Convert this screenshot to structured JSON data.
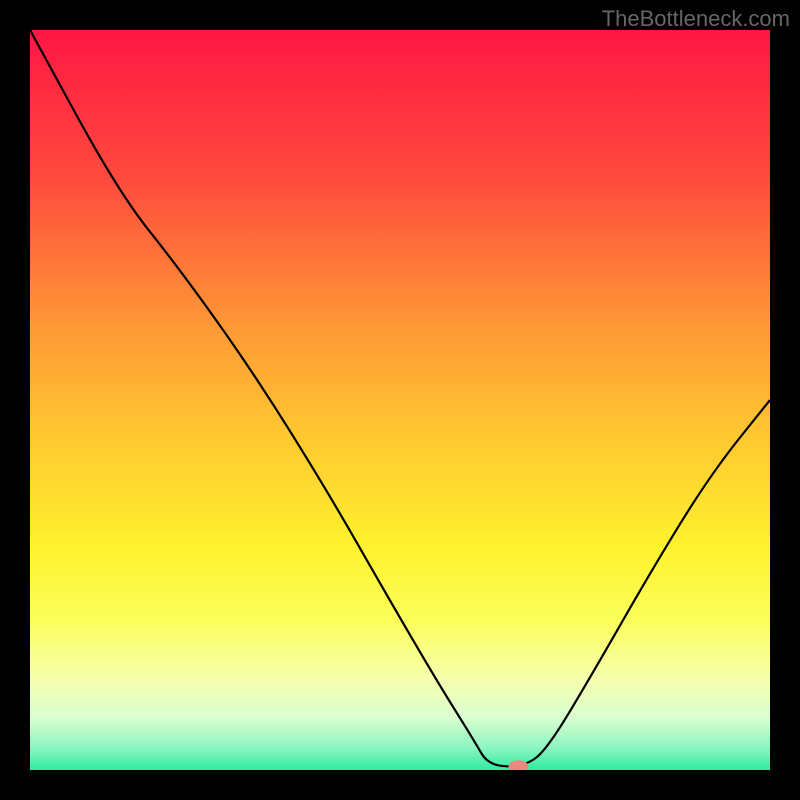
{
  "watermark": "TheBottleneck.com",
  "chart_data": {
    "type": "line",
    "title": "",
    "xlabel": "",
    "ylabel": "",
    "xlim": [
      0,
      100
    ],
    "ylim": [
      0,
      100
    ],
    "gradient_stops": [
      {
        "offset": 0,
        "color": "#ff1744"
      },
      {
        "offset": 20,
        "color": "#ff4a3d"
      },
      {
        "offset": 40,
        "color": "#ff9836"
      },
      {
        "offset": 55,
        "color": "#ffc830"
      },
      {
        "offset": 70,
        "color": "#fff22e"
      },
      {
        "offset": 80,
        "color": "#fcff5c"
      },
      {
        "offset": 88,
        "color": "#f5ffb0"
      },
      {
        "offset": 93,
        "color": "#d8ffd0"
      },
      {
        "offset": 97,
        "color": "#8cf5c0"
      },
      {
        "offset": 100,
        "color": "#2eeba0"
      }
    ],
    "curve": [
      {
        "x": 0,
        "y": 100
      },
      {
        "x": 12,
        "y": 78
      },
      {
        "x": 20,
        "y": 68
      },
      {
        "x": 30,
        "y": 54
      },
      {
        "x": 40,
        "y": 38
      },
      {
        "x": 48,
        "y": 24
      },
      {
        "x": 55,
        "y": 12
      },
      {
        "x": 60,
        "y": 4
      },
      {
        "x": 62,
        "y": 0.5
      },
      {
        "x": 67,
        "y": 0.5
      },
      {
        "x": 70,
        "y": 3
      },
      {
        "x": 76,
        "y": 13
      },
      {
        "x": 84,
        "y": 27
      },
      {
        "x": 92,
        "y": 40
      },
      {
        "x": 100,
        "y": 50
      }
    ],
    "marker": {
      "x": 66,
      "y": 0.5,
      "color": "#e88a80"
    }
  }
}
